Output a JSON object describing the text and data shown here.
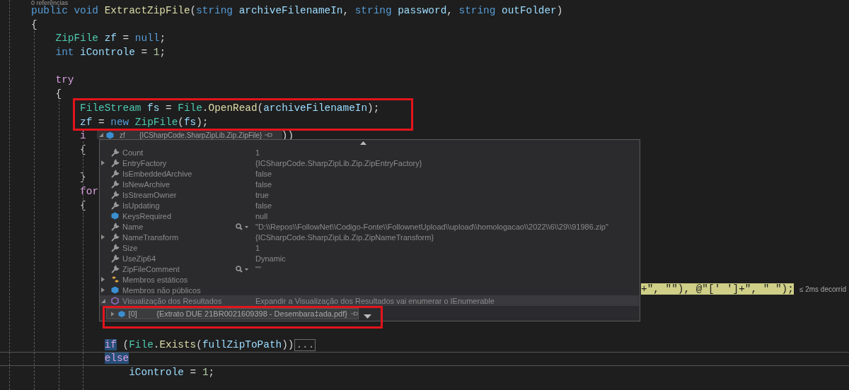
{
  "editor": {
    "codelens": "0 referências",
    "lines": [
      {
        "kind": "code",
        "tokens": [
          {
            "kind": "kw",
            "text": "public void "
          },
          {
            "kind": "method",
            "text": "ExtractZipFile"
          },
          {
            "kind": "plain",
            "text": "("
          },
          {
            "kind": "kw",
            "text": "string "
          },
          {
            "kind": "var",
            "text": "archiveFilenameIn"
          },
          {
            "kind": "plain",
            "text": ", "
          },
          {
            "kind": "kw",
            "text": "string "
          },
          {
            "kind": "var",
            "text": "password"
          },
          {
            "kind": "plain",
            "text": ", "
          },
          {
            "kind": "kw",
            "text": "string "
          },
          {
            "kind": "var",
            "text": "outFolder"
          },
          {
            "kind": "plain",
            "text": ")"
          }
        ]
      },
      {
        "kind": "code",
        "tokens": [
          {
            "kind": "plain",
            "text": "{"
          }
        ],
        "children": [
          {
            "kind": "code",
            "tokens": [
              {
                "kind": "type",
                "text": "ZipFile "
              },
              {
                "kind": "var",
                "text": "zf"
              },
              {
                "kind": "plain",
                "text": " = "
              },
              {
                "kind": "kw",
                "text": "null"
              },
              {
                "kind": "plain",
                "text": ";"
              }
            ]
          },
          {
            "kind": "code",
            "tokens": [
              {
                "kind": "kw",
                "text": "int "
              },
              {
                "kind": "var",
                "text": "iControle"
              },
              {
                "kind": "plain",
                "text": " = "
              },
              {
                "kind": "num",
                "text": "1"
              },
              {
                "kind": "plain",
                "text": ";"
              }
            ]
          },
          {
            "kind": "blank"
          },
          {
            "kind": "code",
            "tokens": [
              {
                "kind": "ctrl",
                "text": "try"
              }
            ]
          },
          {
            "kind": "code",
            "tokens": [
              {
                "kind": "plain",
                "text": "{"
              }
            ],
            "children": [
              {
                "kind": "code",
                "tokens": [
                  {
                    "kind": "type",
                    "text": "FileStream "
                  },
                  {
                    "kind": "var",
                    "text": "fs"
                  },
                  {
                    "kind": "plain",
                    "text": " = "
                  },
                  {
                    "kind": "type",
                    "text": "File"
                  },
                  {
                    "kind": "plain",
                    "text": "."
                  },
                  {
                    "kind": "method",
                    "text": "OpenRead"
                  },
                  {
                    "kind": "plain",
                    "text": "("
                  },
                  {
                    "kind": "var",
                    "text": "archiveFilenameIn"
                  },
                  {
                    "kind": "plain",
                    "text": ");"
                  }
                ]
              },
              {
                "kind": "code",
                "tokens": [
                  {
                    "kind": "var",
                    "text": "zf"
                  },
                  {
                    "kind": "plain",
                    "text": " = "
                  },
                  {
                    "kind": "kw",
                    "text": "new "
                  },
                  {
                    "kind": "type",
                    "text": "ZipFile"
                  },
                  {
                    "kind": "plain",
                    "text": "("
                  },
                  {
                    "kind": "var",
                    "text": "fs"
                  },
                  {
                    "kind": "plain",
                    "text": ");"
                  }
                ]
              },
              {
                "kind": "code",
                "tokens": [
                  {
                    "kind": "ctrl",
                    "text": "i"
                  }
                ],
                "trailing": [
                  {
                    "kind": "plain",
                    "text": "))"
                  }
                ]
              },
              {
                "kind": "code",
                "tokens": [
                  {
                    "kind": "plain",
                    "text": "{"
                  }
                ]
              },
              {
                "kind": "blank"
              },
              {
                "kind": "code",
                "tokens": [
                  {
                    "kind": "plain",
                    "text": "}"
                  }
                ]
              },
              {
                "kind": "code",
                "tokens": [
                  {
                    "kind": "ctrl",
                    "text": "for"
                  }
                ]
              },
              {
                "kind": "code",
                "tokens": [
                  {
                    "kind": "plain",
                    "text": "{"
                  }
                ],
                "children": [
                  {
                    "kind": "blank"
                  },
                  {
                    "kind": "blank"
                  },
                  {
                    "kind": "blank"
                  },
                  {
                    "kind": "blank"
                  },
                  {
                    "kind": "blank"
                  },
                  {
                    "kind": "past_panel",
                    "tokens": [
                      {
                        "kind": "step",
                        "text": "+\", \"\"), @\"[' ']+\", \" \");"
                      }
                    ],
                    "hint": "≤ 2ms decorrid"
                  },
                  {
                    "kind": "blank"
                  },
                  {
                    "kind": "blank"
                  },
                  {
                    "kind": "blank"
                  },
                  {
                    "kind": "code",
                    "tokens": [
                      {
                        "kind": "sel",
                        "text": "if"
                      },
                      {
                        "kind": "plain",
                        "text": " ("
                      },
                      {
                        "kind": "type",
                        "text": "File"
                      },
                      {
                        "kind": "plain",
                        "text": "."
                      },
                      {
                        "kind": "method",
                        "text": "Exists"
                      },
                      {
                        "kind": "plain",
                        "text": "("
                      },
                      {
                        "kind": "var",
                        "text": "fullZipToPath"
                      },
                      {
                        "kind": "plain",
                        "text": "))"
                      }
                    ],
                    "fold": "..."
                  },
                  {
                    "kind": "code",
                    "framed": true,
                    "tokens": [
                      {
                        "kind": "sel",
                        "text": "else"
                      }
                    ],
                    "children": [
                      {
                        "kind": "code",
                        "tokens": [
                          {
                            "kind": "var",
                            "text": "iControle"
                          },
                          {
                            "kind": "plain",
                            "text": " = "
                          },
                          {
                            "kind": "num",
                            "text": "1"
                          },
                          {
                            "kind": "plain",
                            "text": ";"
                          }
                        ]
                      }
                    ]
                  }
                ]
              }
            ]
          }
        ]
      }
    ]
  },
  "datatip": {
    "header": {
      "name": "zf",
      "value": "{ICSharpCode.SharpZipLib.Zip.ZipFile}",
      "expandable": true,
      "expanded": true
    },
    "rows": [
      {
        "kind": "property",
        "name": "Count",
        "value": "1",
        "expandable": false,
        "viewer": false,
        "selected": false
      },
      {
        "kind": "property",
        "name": "EntryFactory",
        "value": "{ICSharpCode.SharpZipLib.Zip.ZipEntryFactory}",
        "expandable": true,
        "expanded": false,
        "viewer": false,
        "selected": false
      },
      {
        "kind": "property",
        "name": "IsEmbeddedArchive",
        "value": "false",
        "expandable": false,
        "viewer": false,
        "selected": false
      },
      {
        "kind": "property",
        "name": "IsNewArchive",
        "value": "false",
        "expandable": false,
        "viewer": false,
        "selected": false
      },
      {
        "kind": "property",
        "name": "IsStreamOwner",
        "value": "true",
        "expandable": false,
        "viewer": false,
        "selected": false
      },
      {
        "kind": "property",
        "name": "IsUpdating",
        "value": "false",
        "expandable": false,
        "viewer": false,
        "selected": false
      },
      {
        "kind": "field",
        "name": "KeysRequired",
        "value": "null",
        "expandable": false,
        "viewer": false,
        "selected": false
      },
      {
        "kind": "property",
        "name": "Name",
        "value": "\"D:\\\\Repos\\\\FollowNet\\\\Codigo-Fonte\\\\FollownetUpload\\\\upload\\\\homologacao\\\\2022\\\\6\\\\29\\\\91986.zip\"",
        "expandable": false,
        "viewer": true,
        "selected": false
      },
      {
        "kind": "property",
        "name": "NameTransform",
        "value": "{ICSharpCode.SharpZipLib.Zip.ZipNameTransform}",
        "expandable": true,
        "expanded": false,
        "viewer": false,
        "selected": false
      },
      {
        "kind": "property",
        "name": "Size",
        "value": "1",
        "expandable": false,
        "viewer": false,
        "selected": false
      },
      {
        "kind": "property",
        "name": "UseZip64",
        "value": "Dynamic",
        "expandable": false,
        "viewer": false,
        "selected": false
      },
      {
        "kind": "property",
        "name": "ZipFileComment",
        "value": "\"\"",
        "expandable": false,
        "viewer": true,
        "selected": false
      },
      {
        "kind": "static",
        "name": "Membros estáticos",
        "expandable": true,
        "expanded": false,
        "viewer": false,
        "selected": false
      },
      {
        "kind": "field",
        "name": "Membros não públicos",
        "expandable": true,
        "expanded": false,
        "viewer": false,
        "selected": false
      },
      {
        "kind": "results",
        "name": "Visualização dos Resultados",
        "value": "Expandir a Visualização dos Resultados vai enumerar o IEnumerable",
        "expandable": true,
        "expanded": true,
        "viewer": false,
        "selected": true
      }
    ],
    "child": {
      "name": "[0]",
      "value": "{Extrato DUE 21BR0021609398 - Desembara‡ada.pdf}",
      "expandable": true,
      "expanded": false
    }
  },
  "annotations": [
    {
      "kind": "box"
    },
    {
      "kind": "box"
    }
  ]
}
